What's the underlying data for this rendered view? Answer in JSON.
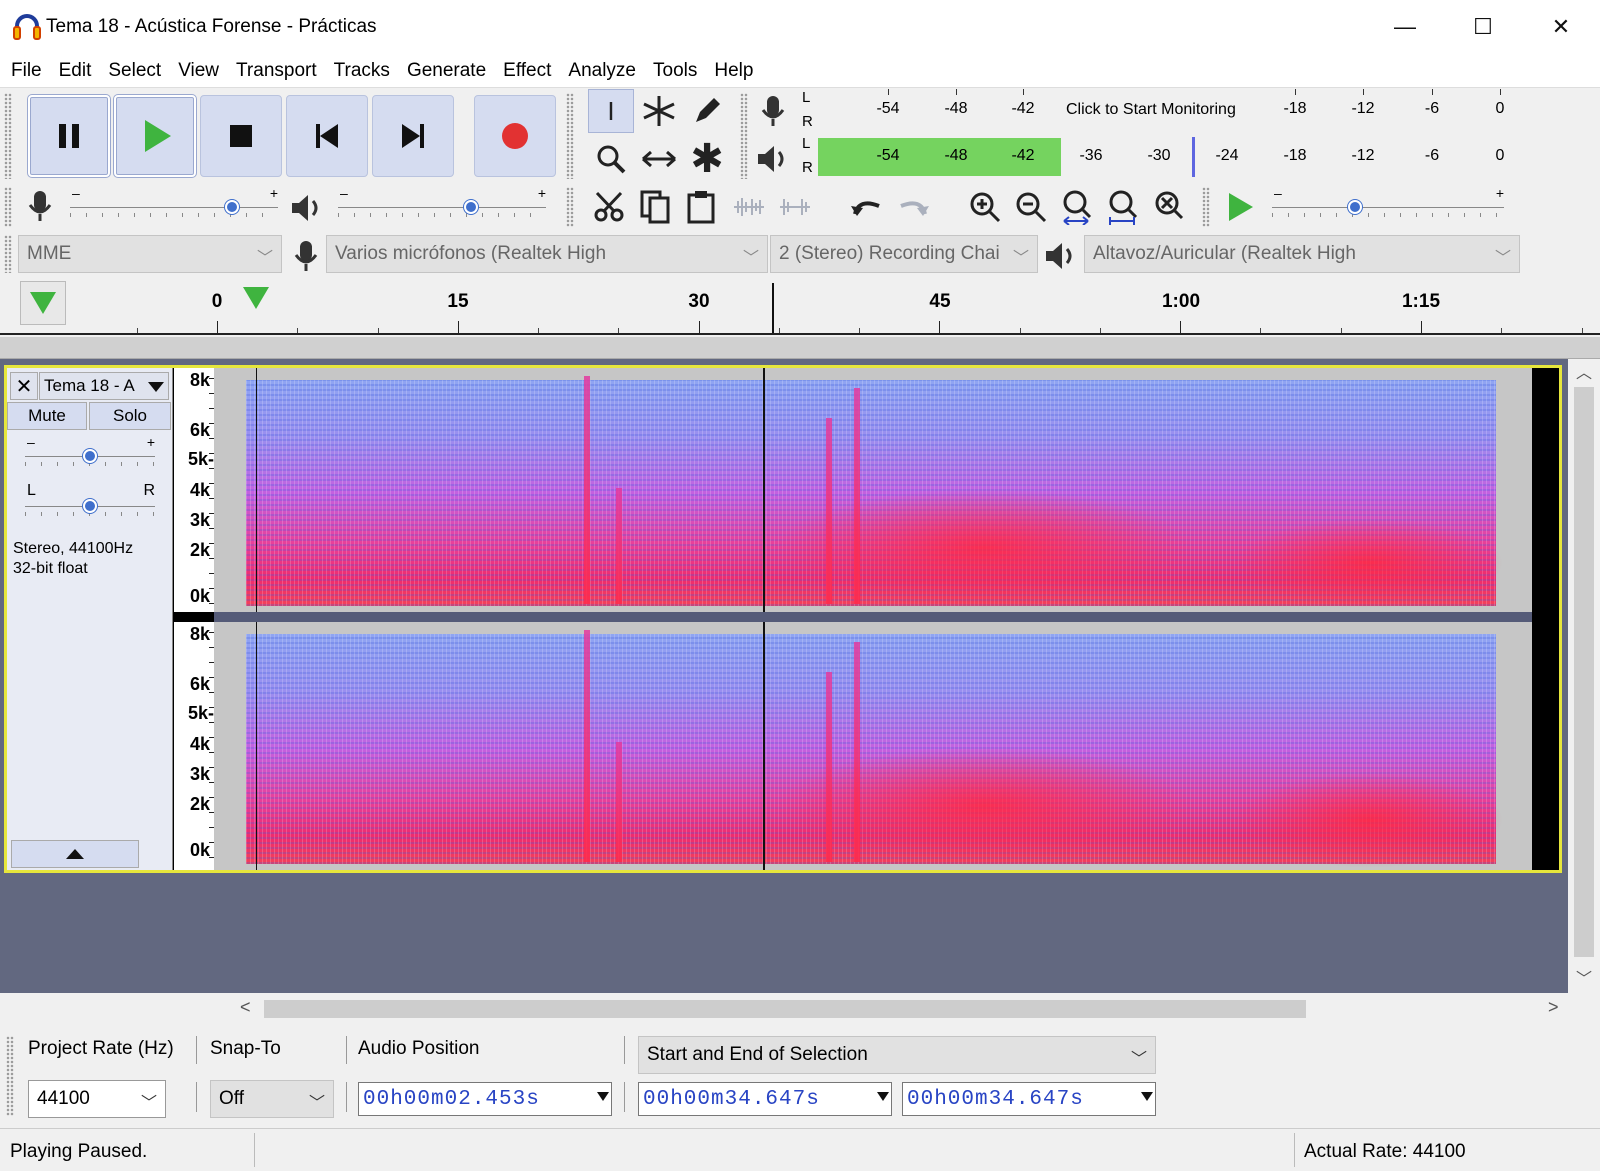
{
  "window": {
    "title": "Tema 18 - Acústica Forense - Prácticas",
    "minimize": "—",
    "maximize": "☐",
    "close": "✕"
  },
  "menu": [
    "File",
    "Edit",
    "Select",
    "View",
    "Transport",
    "Tracks",
    "Generate",
    "Effect",
    "Analyze",
    "Tools",
    "Help"
  ],
  "meters": {
    "record_ticks": [
      "-54",
      "-48",
      "-42",
      "-18",
      "-12",
      "-6",
      "0"
    ],
    "record_message": "Click to Start Monitoring",
    "playback_ticks": [
      "-54",
      "-48",
      "-42",
      "-36",
      "-30",
      "-24",
      "-18",
      "-12",
      "-6",
      "0"
    ],
    "left": "L",
    "right": "R",
    "playback_level_db": -42,
    "playback_peak_db": -30
  },
  "mixer": {
    "minus": "–",
    "plus": "+",
    "record_volume": 0.8,
    "playback_volume": 0.65,
    "play_speed": 0.35
  },
  "devices": {
    "host": "MME",
    "recording_device": "Varios micrófonos (Realtek High",
    "channels": "2 (Stereo) Recording Chai",
    "playback_device": "Altavoz/Auricular (Realtek High"
  },
  "ruler": {
    "labels": [
      "0",
      "15",
      "30",
      "45",
      "1:00",
      "1:15"
    ]
  },
  "track": {
    "name": "Tema 18 - A",
    "close": "✕",
    "mute": "Mute",
    "solo": "Solo",
    "gain_minus": "–",
    "gain_plus": "+",
    "pan_left": "L",
    "pan_right": "R",
    "format": "Stereo, 44100Hz",
    "bit_depth": "32-bit float",
    "freq_labels": [
      "8k",
      "6k",
      "5k-",
      "4k",
      "3k",
      "2k",
      "0k"
    ],
    "gain": 0.5,
    "pan": 0.5
  },
  "selection": {
    "project_rate_label": "Project Rate (Hz)",
    "project_rate": "44100",
    "snap_label": "Snap-To",
    "snap_value": "Off",
    "audio_position_label": "Audio Position",
    "audio_position": "00h00m02.453s",
    "selection_mode": "Start and End of Selection",
    "selection_start": "00h00m34.647s",
    "selection_end": "00h00m34.647s"
  },
  "status": {
    "left": "Playing Paused.",
    "right": "Actual Rate: 44100"
  },
  "colors": {
    "track_border": "#e6e63c",
    "play_green": "#3fb43f",
    "record_red": "#e23232",
    "meter_green": "#75d35f",
    "time_blue": "#2844c4"
  }
}
